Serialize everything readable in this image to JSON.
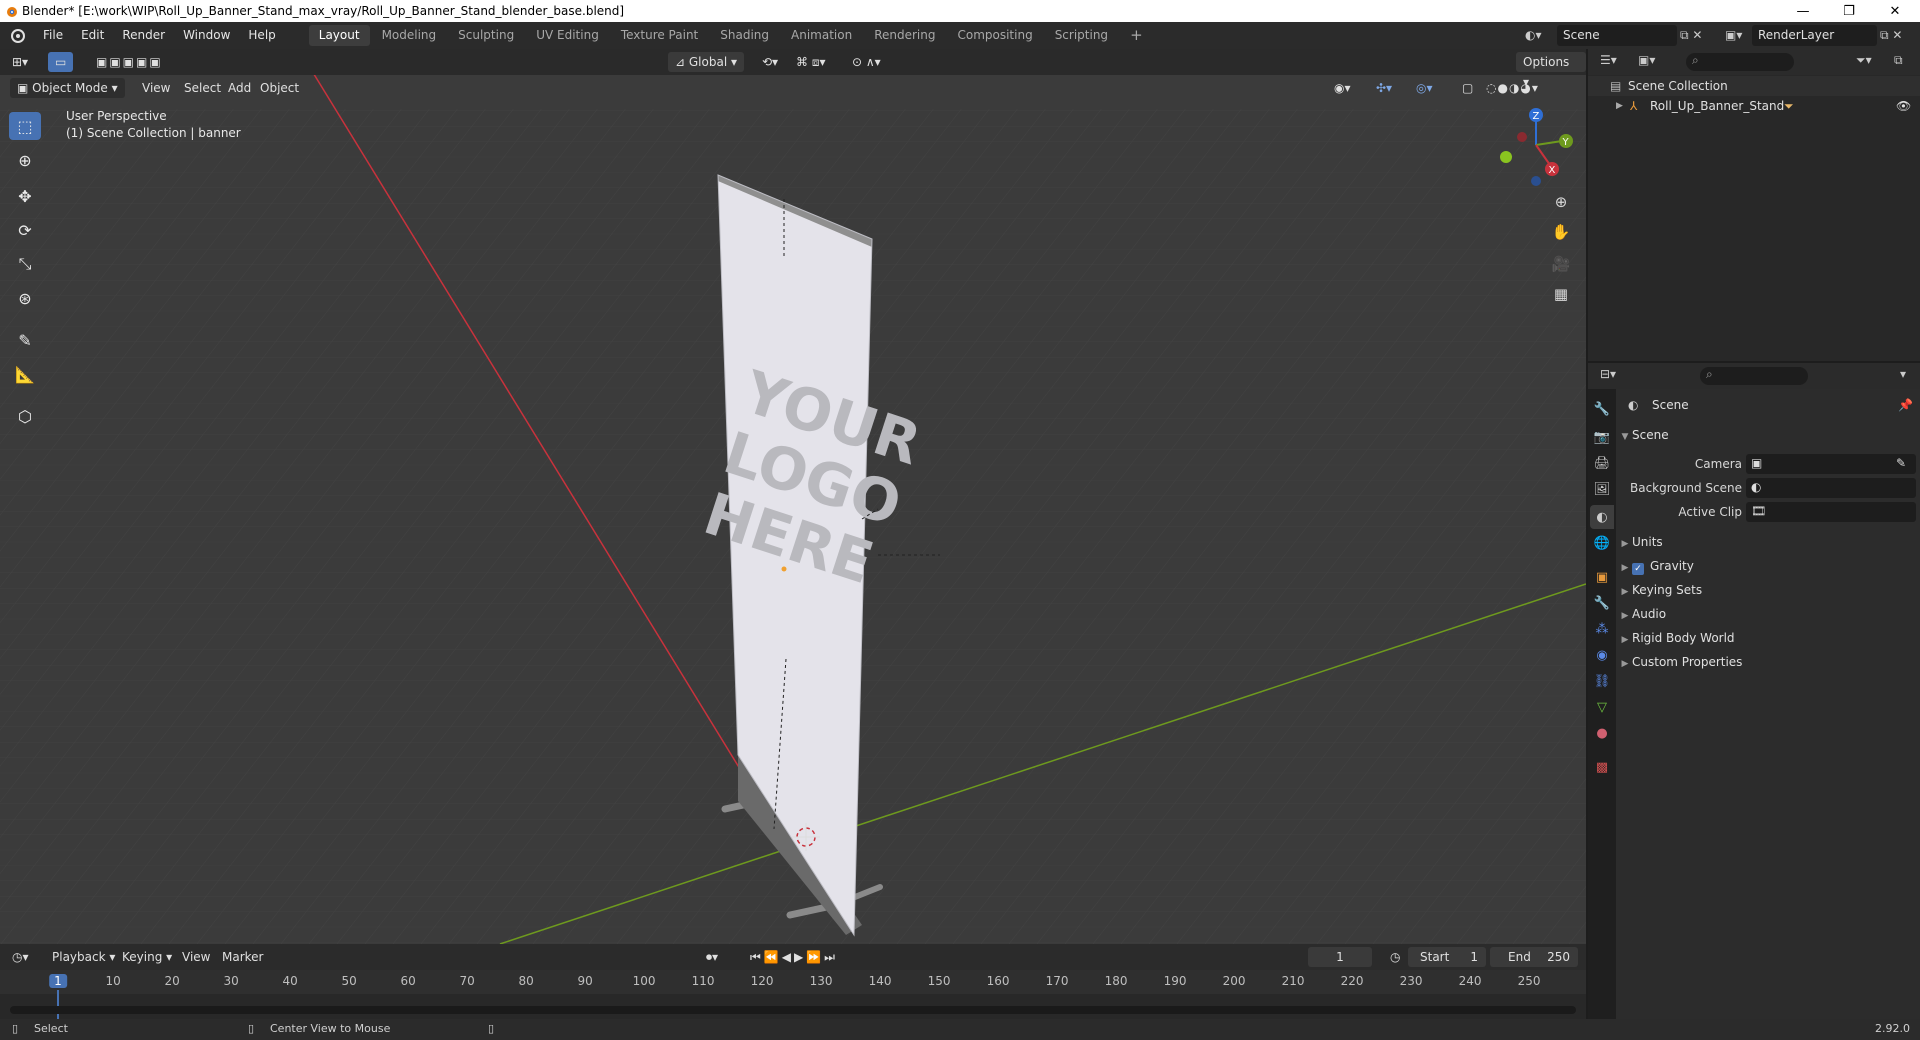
{
  "window": {
    "title": "Blender* [E:\\work\\WIP\\Roll_Up_Banner_Stand_max_vray/Roll_Up_Banner_Stand_blender_base.blend]",
    "minimize": "—",
    "maximize": "❐",
    "close": "✕"
  },
  "menu": [
    "File",
    "Edit",
    "Render",
    "Window",
    "Help"
  ],
  "workspaces": [
    "Layout",
    "Modeling",
    "Sculpting",
    "UV Editing",
    "Texture Paint",
    "Shading",
    "Animation",
    "Rendering",
    "Compositing",
    "Scripting"
  ],
  "active_workspace": "Layout",
  "scene_selector": {
    "value": "Scene"
  },
  "renderlayer_selector": {
    "value": "RenderLayer"
  },
  "viewport": {
    "transform_orientation": "Global",
    "options_label": "Options",
    "mode": "Object Mode",
    "header_menus": [
      "View",
      "Select",
      "Add",
      "Object"
    ],
    "info_line1": "User Perspective",
    "info_line2": "(1) Scene Collection | banner",
    "banner_text": [
      "YOUR",
      "LOGO",
      "HERE"
    ],
    "gizmo_axes": {
      "z": "Z",
      "y": "Y",
      "x": "X"
    }
  },
  "outliner": {
    "search_placeholder": "",
    "rows": [
      {
        "label": "Scene Collection",
        "icon": "collection-icon"
      },
      {
        "label": "Roll_Up_Banner_Stand",
        "icon": "object-icon"
      }
    ]
  },
  "properties": {
    "search_placeholder": "",
    "context_title": "Scene",
    "panel_title": "Scene",
    "fields": [
      {
        "label": "Camera",
        "value": ""
      },
      {
        "label": "Background Scene",
        "value": ""
      },
      {
        "label": "Active Clip",
        "value": ""
      }
    ],
    "subpanels": [
      "Units",
      "Gravity",
      "Keying Sets",
      "Audio",
      "Rigid Body World",
      "Custom Properties"
    ],
    "gravity_checked": true
  },
  "timeline": {
    "menus": [
      "Playback",
      "Keying",
      "View",
      "Marker"
    ],
    "current_frame": "1",
    "start_label": "Start",
    "start_value": "1",
    "end_label": "End",
    "end_value": "250",
    "ruler_labels": [
      "1",
      "10",
      "20",
      "30",
      "40",
      "50",
      "60",
      "70",
      "80",
      "90",
      "100",
      "110",
      "120",
      "130",
      "140",
      "150",
      "160",
      "170",
      "180",
      "190",
      "200",
      "210",
      "220",
      "230",
      "240",
      "250"
    ]
  },
  "statusbar": {
    "left_action": "Select",
    "mid_action": "Center View to Mouse",
    "version": "2.92.0"
  },
  "colors": {
    "accent": "#4772b3",
    "x_axis": "#c8323c",
    "y_axis": "#6e9a1e",
    "z_axis": "#2f6fd6"
  }
}
